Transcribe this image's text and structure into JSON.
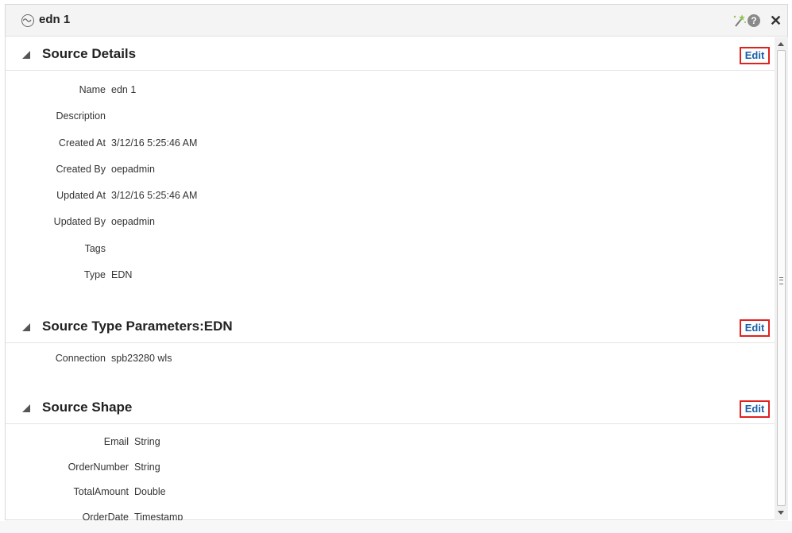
{
  "window": {
    "title": "edn 1"
  },
  "toolbar": {
    "help_label": "?",
    "close_label": "✕"
  },
  "sections": {
    "source_details": {
      "title": "Source Details",
      "edit_label": "Edit",
      "fields": [
        {
          "label": "Name",
          "value": "edn 1"
        },
        {
          "label": "Description",
          "value": ""
        },
        {
          "label": "Created At",
          "value": "3/12/16 5:25:46 AM"
        },
        {
          "label": "Created By",
          "value": "oepadmin"
        },
        {
          "label": "Updated At",
          "value": "3/12/16 5:25:46 AM"
        },
        {
          "label": "Updated By",
          "value": "oepadmin"
        },
        {
          "label": "Tags",
          "value": ""
        },
        {
          "label": "Type",
          "value": "EDN"
        }
      ]
    },
    "source_type_params": {
      "title": "Source Type Parameters:EDN",
      "edit_label": "Edit",
      "fields": [
        {
          "label": "Connection",
          "value": "spb23280 wls"
        }
      ]
    },
    "source_shape": {
      "title": "Source Shape",
      "edit_label": "Edit",
      "fields": [
        {
          "label": "Email",
          "value": "String"
        },
        {
          "label": "OrderNumber",
          "value": "String"
        },
        {
          "label": "TotalAmount",
          "value": "Double"
        },
        {
          "label": "OrderDate",
          "value": "Timestamp"
        }
      ]
    }
  },
  "colors": {
    "edit_border": "#e0221f",
    "edit_text": "#1a5fa8"
  },
  "icons": {
    "title": "source-stream-icon",
    "magic": "magic-wand-icon",
    "help": "help-icon",
    "close": "close-icon",
    "collapse": "collapse-triangle-icon"
  }
}
